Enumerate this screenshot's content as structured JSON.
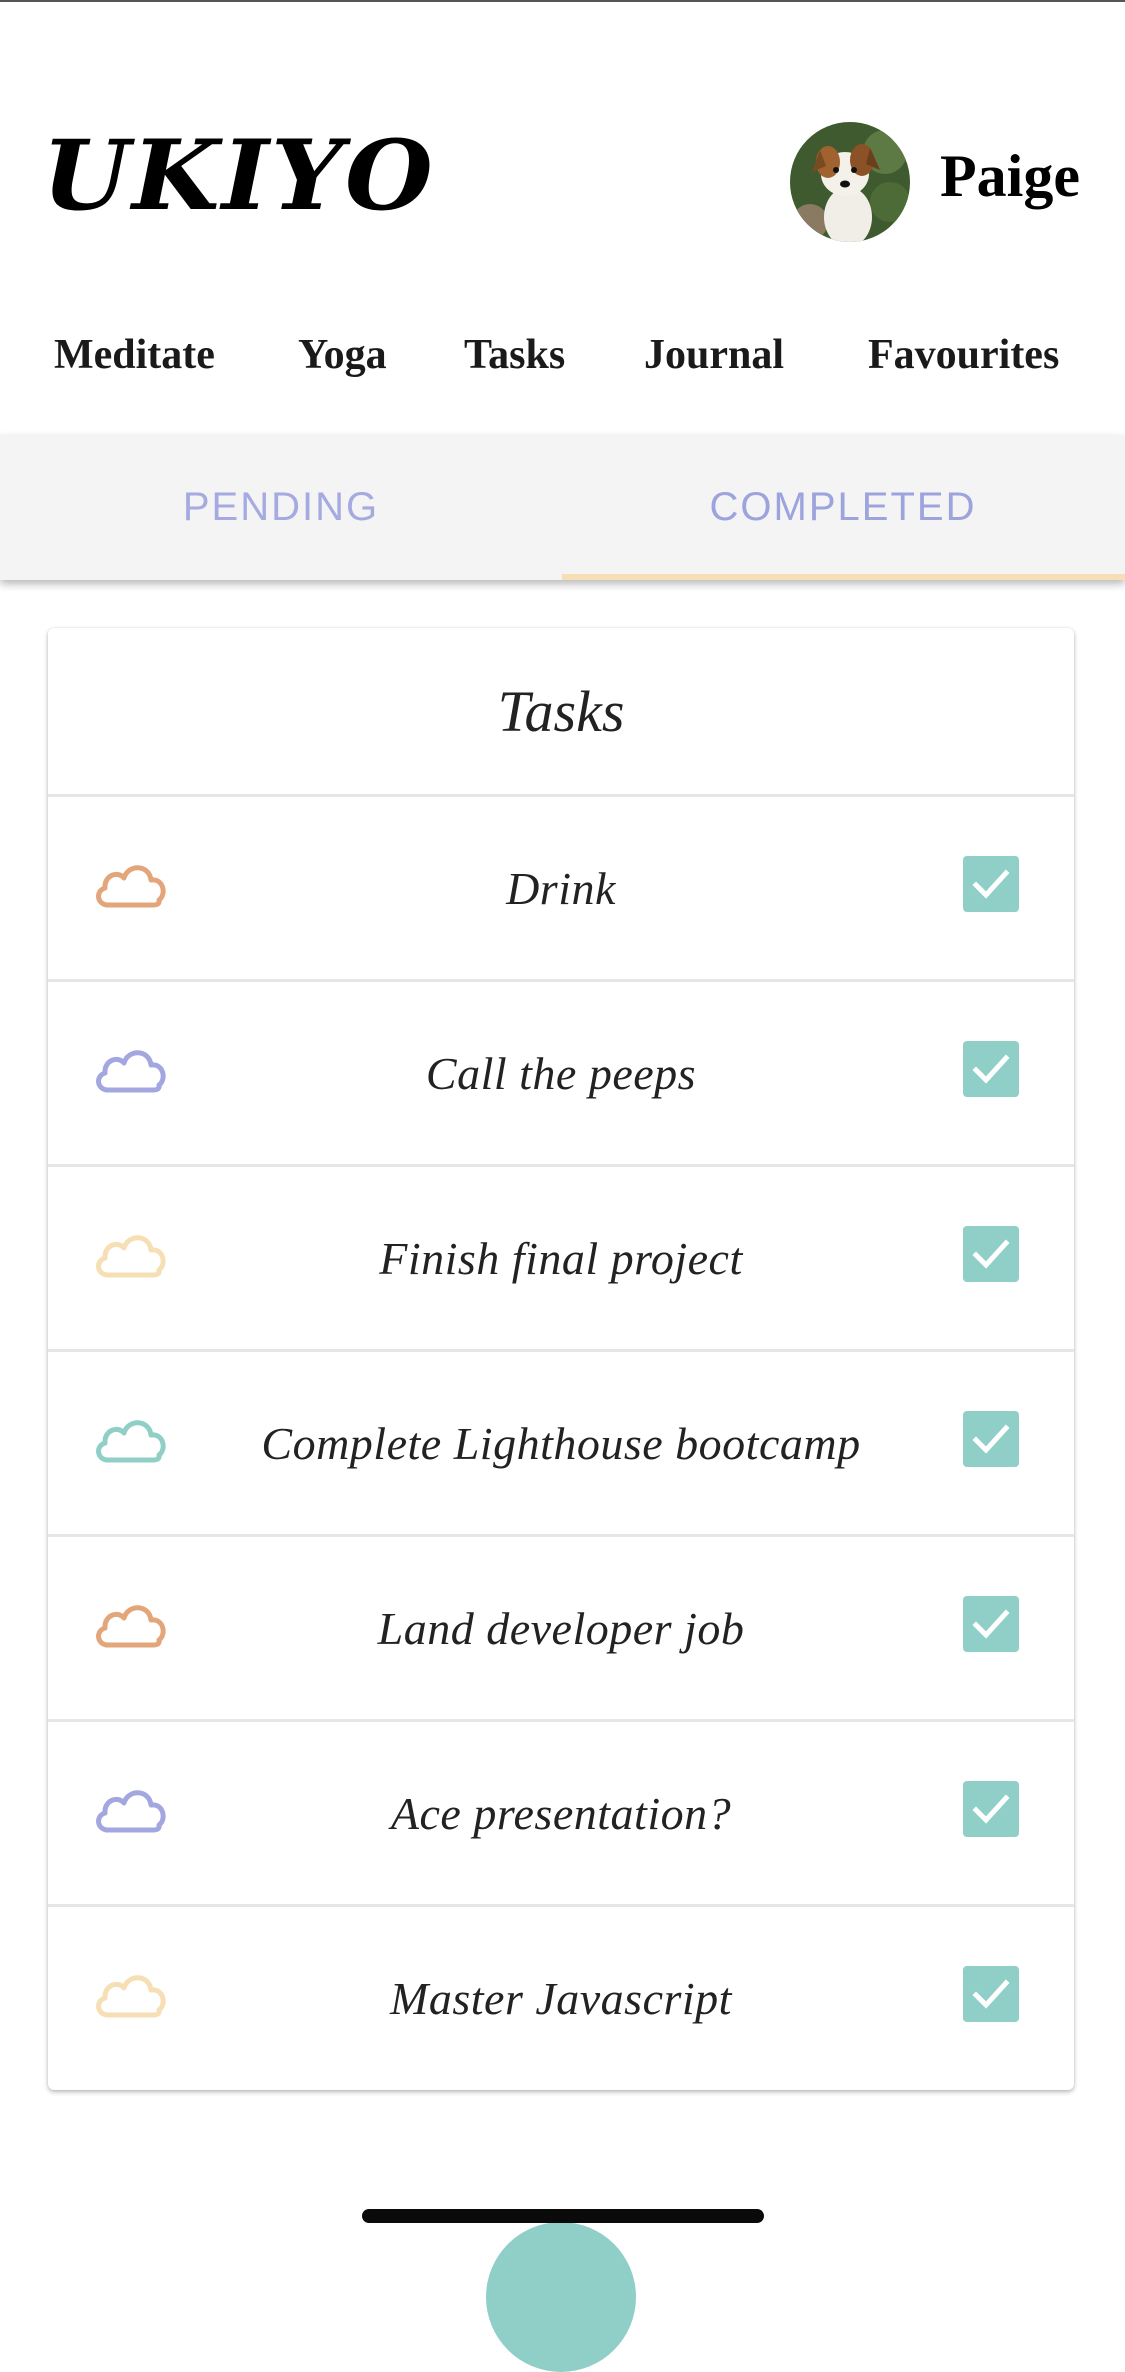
{
  "app": {
    "logo": "UKIYO"
  },
  "user": {
    "name": "Paige"
  },
  "nav": {
    "items": [
      "Meditate",
      "Yoga",
      "Tasks",
      "Journal",
      "Favourites"
    ]
  },
  "tabs": {
    "pending": "PENDING",
    "completed": "COMPLETED",
    "active": "COMPLETED"
  },
  "card": {
    "title": "Tasks",
    "tasks": [
      {
        "label": "Drink",
        "cloud_color": "#e3a57a",
        "completed": true
      },
      {
        "label": "Call the peeps",
        "cloud_color": "#a3a7e0",
        "completed": true
      },
      {
        "label": "Finish final project",
        "cloud_color": "#f6dfb4",
        "completed": true
      },
      {
        "label": "Complete Lighthouse bootcamp",
        "cloud_color": "#8fcfc7",
        "completed": true
      },
      {
        "label": "Land developer job",
        "cloud_color": "#e3a57a",
        "completed": true
      },
      {
        "label": "Ace presentation?",
        "cloud_color": "#a3a7e0",
        "completed": true
      },
      {
        "label": "Master Javascript",
        "cloud_color": "#f6dfb4",
        "completed": true
      }
    ]
  },
  "colors": {
    "accent": "#8fcfc7",
    "tab_text": "#a5aae0",
    "tab_indicator": "#f6dfb4"
  },
  "icons": {
    "task_icon": "cloud-icon",
    "check_icon": "checkbox-checked-icon"
  }
}
